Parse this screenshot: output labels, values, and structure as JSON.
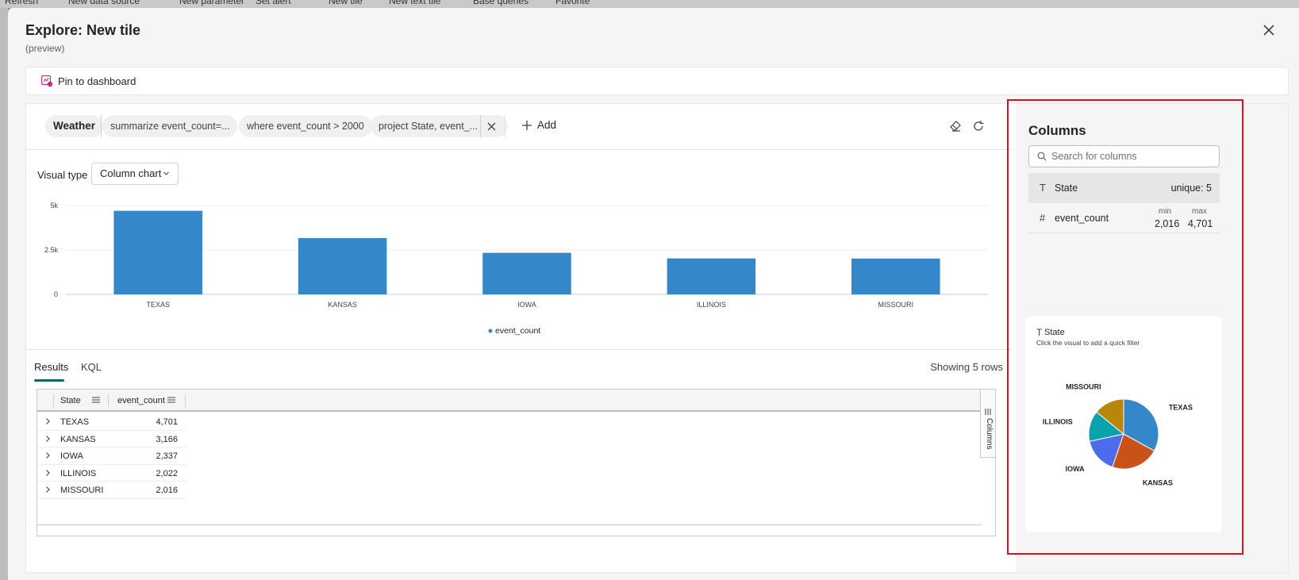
{
  "background": {
    "toolbar_items": [
      "Refresh",
      "New data source",
      "New parameter",
      "Set alert",
      "New tile",
      "New text tile",
      "Base queries",
      "Favorite"
    ]
  },
  "dialog": {
    "title": "Explore: New tile",
    "subtitle": "(preview)",
    "pin_label": "Pin to dashboard"
  },
  "query": {
    "source": "Weather",
    "steps": [
      "summarize event_count=...",
      "where event_count > 2000",
      "project State, event_..."
    ],
    "add_label": "Add"
  },
  "visual": {
    "label": "Visual type",
    "selected": "Column chart"
  },
  "chart_data": {
    "type": "bar",
    "categories": [
      "TEXAS",
      "KANSAS",
      "IOWA",
      "ILLINOIS",
      "MISSOURI"
    ],
    "series": [
      {
        "name": "event_count",
        "values": [
          4701,
          3166,
          2337,
          2022,
          2016
        ],
        "color": "#3487c9"
      }
    ],
    "y_ticks": [
      {
        "value": 0,
        "label": "0"
      },
      {
        "value": 2500,
        "label": "2.5k"
      },
      {
        "value": 5000,
        "label": "5k"
      }
    ],
    "ylim": [
      0,
      5000
    ],
    "legend": "bottom",
    "grid": true
  },
  "results": {
    "tabs": [
      "Results",
      "KQL"
    ],
    "active_tab": "Results",
    "row_count": "Showing 5 rows",
    "columns": [
      "State",
      "event_count"
    ],
    "side_label": "Columns",
    "rows": [
      {
        "State": "TEXAS",
        "event_count": "4,701"
      },
      {
        "State": "KANSAS",
        "event_count": "3,166"
      },
      {
        "State": "IOWA",
        "event_count": "2,337"
      },
      {
        "State": "ILLINOIS",
        "event_count": "2,022"
      },
      {
        "State": "MISSOURI",
        "event_count": "2,016"
      }
    ]
  },
  "columns_panel": {
    "title": "Columns",
    "search_placeholder": "Search for columns",
    "items": [
      {
        "type_icon": "T",
        "name": "State",
        "stat": "unique: 5"
      },
      {
        "type_icon": "#",
        "name": "event_count",
        "min_label": "min",
        "max_label": "max",
        "min": "2,016",
        "max": "4,701"
      }
    ],
    "pie": {
      "title": "State",
      "hint": "Click the visual to add a quick filter",
      "slices": [
        {
          "label": "TEXAS",
          "value": 4701,
          "color": "#3487c9"
        },
        {
          "label": "KANSAS",
          "value": 3166,
          "color": "#c8521a"
        },
        {
          "label": "IOWA",
          "value": 2337,
          "color": "#4f6bed"
        },
        {
          "label": "ILLINOIS",
          "value": 2022,
          "color": "#0aa3ad"
        },
        {
          "label": "MISSOURI",
          "value": 2016,
          "color": "#b8860b"
        }
      ]
    }
  }
}
